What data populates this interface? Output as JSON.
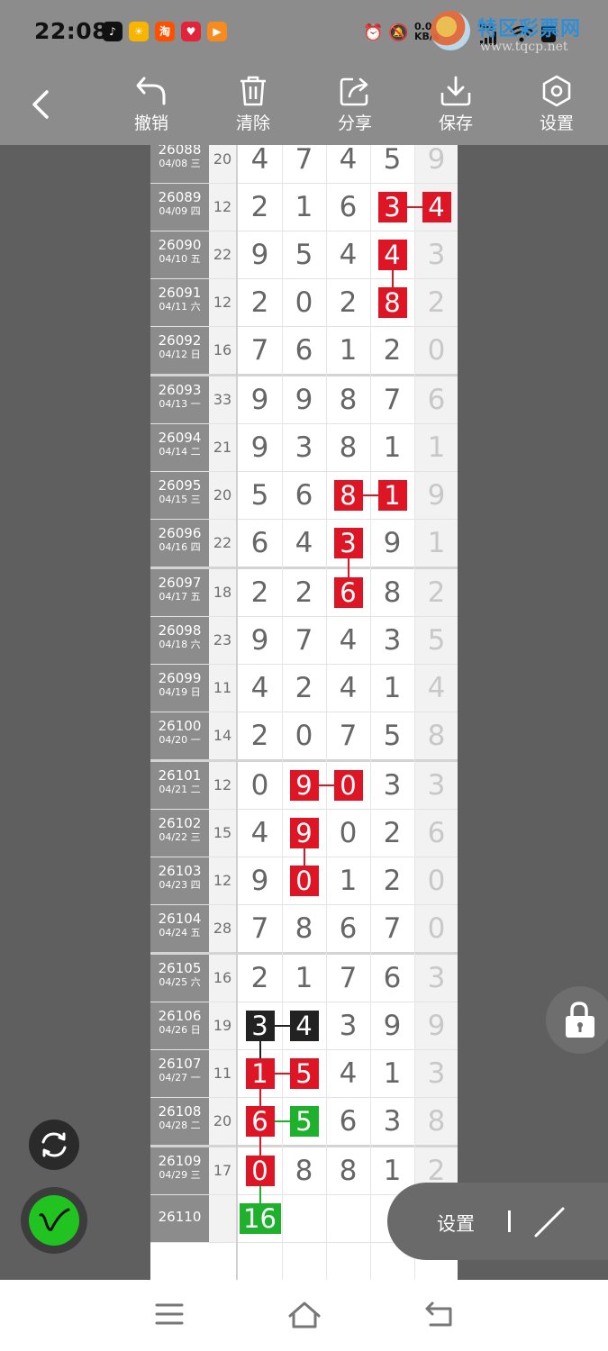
{
  "status_bar": {
    "time": "22:08",
    "apps": [
      {
        "icon": "tiktok-icon",
        "color": "#111111",
        "glyph": "♪"
      },
      {
        "icon": "sun-app-icon",
        "color": "#f7b500",
        "glyph": "☀"
      },
      {
        "icon": "taobao-icon",
        "color": "#ff5000",
        "glyph": "淘"
      },
      {
        "icon": "heart-app-icon",
        "color": "#e2233a",
        "glyph": "♥"
      },
      {
        "icon": "video-app-icon",
        "color": "#f68b1f",
        "glyph": "▶"
      }
    ],
    "net_speed": "0.0",
    "net_unit": "KB/s",
    "net_type": "5G",
    "watermark_title": "特区彩票网",
    "watermark_url": "www.tqcp.net"
  },
  "toolbar": {
    "undo_label": "撤销",
    "clear_label": "清除",
    "share_label": "分享",
    "save_label": "保存",
    "settings_label": "设置"
  },
  "grid": {
    "rows": [
      {
        "id": "26088",
        "date": "04/08 三",
        "sum": "20",
        "d": [
          "4",
          "7",
          "4",
          "5"
        ],
        "extra": "9"
      },
      {
        "id": "26089",
        "date": "04/09 四",
        "sum": "12",
        "d": [
          "2",
          "1",
          "6",
          "3"
        ],
        "extra": "4"
      },
      {
        "id": "26090",
        "date": "04/10 五",
        "sum": "22",
        "d": [
          "9",
          "5",
          "4",
          "4"
        ],
        "extra": "3"
      },
      {
        "id": "26091",
        "date": "04/11 六",
        "sum": "12",
        "d": [
          "2",
          "0",
          "2",
          "8"
        ],
        "extra": "2"
      },
      {
        "id": "26092",
        "date": "04/12 日",
        "sum": "16",
        "d": [
          "7",
          "6",
          "1",
          "2"
        ],
        "extra": "0"
      },
      {
        "id": "26093",
        "date": "04/13 一",
        "sum": "33",
        "d": [
          "9",
          "9",
          "8",
          "7"
        ],
        "extra": "6"
      },
      {
        "id": "26094",
        "date": "04/14 二",
        "sum": "21",
        "d": [
          "9",
          "3",
          "8",
          "1"
        ],
        "extra": "1"
      },
      {
        "id": "26095",
        "date": "04/15 三",
        "sum": "20",
        "d": [
          "5",
          "6",
          "8",
          "1"
        ],
        "extra": "9"
      },
      {
        "id": "26096",
        "date": "04/16 四",
        "sum": "22",
        "d": [
          "6",
          "4",
          "3",
          "9"
        ],
        "extra": "1"
      },
      {
        "id": "26097",
        "date": "04/17 五",
        "sum": "18",
        "d": [
          "2",
          "2",
          "6",
          "8"
        ],
        "extra": "2"
      },
      {
        "id": "26098",
        "date": "04/18 六",
        "sum": "23",
        "d": [
          "9",
          "7",
          "4",
          "3"
        ],
        "extra": "5"
      },
      {
        "id": "26099",
        "date": "04/19 日",
        "sum": "11",
        "d": [
          "4",
          "2",
          "4",
          "1"
        ],
        "extra": "4"
      },
      {
        "id": "26100",
        "date": "04/20 一",
        "sum": "14",
        "d": [
          "2",
          "0",
          "7",
          "5"
        ],
        "extra": "8"
      },
      {
        "id": "26101",
        "date": "04/21 二",
        "sum": "12",
        "d": [
          "0",
          "9",
          "0",
          "3"
        ],
        "extra": "3"
      },
      {
        "id": "26102",
        "date": "04/22 三",
        "sum": "15",
        "d": [
          "4",
          "9",
          "0",
          "2"
        ],
        "extra": "6"
      },
      {
        "id": "26103",
        "date": "04/23 四",
        "sum": "12",
        "d": [
          "9",
          "0",
          "1",
          "2"
        ],
        "extra": "0"
      },
      {
        "id": "26104",
        "date": "04/24 五",
        "sum": "28",
        "d": [
          "7",
          "8",
          "6",
          "7"
        ],
        "extra": "0"
      },
      {
        "id": "26105",
        "date": "04/25 六",
        "sum": "16",
        "d": [
          "2",
          "1",
          "7",
          "6"
        ],
        "extra": "3"
      },
      {
        "id": "26106",
        "date": "04/26 日",
        "sum": "19",
        "d": [
          "3",
          "4",
          "3",
          "9"
        ],
        "extra": "9"
      },
      {
        "id": "26107",
        "date": "04/27 一",
        "sum": "11",
        "d": [
          "1",
          "5",
          "4",
          "1"
        ],
        "extra": "3"
      },
      {
        "id": "26108",
        "date": "04/28 二",
        "sum": "20",
        "d": [
          "6",
          "5",
          "6",
          "3"
        ],
        "extra": "8"
      },
      {
        "id": "26109",
        "date": "04/29 三",
        "sum": "17",
        "d": [
          "0",
          "8",
          "8",
          "1"
        ],
        "extra": "2"
      },
      {
        "id": "26110",
        "date": "",
        "sum": "",
        "d": [
          "16",
          "",
          "",
          ""
        ],
        "extra": ""
      }
    ],
    "marks": [
      {
        "row": 1,
        "col": 3,
        "color": "red"
      },
      {
        "row": 1,
        "col": 4,
        "color": "red"
      },
      {
        "row": 2,
        "col": 3,
        "color": "red"
      },
      {
        "row": 3,
        "col": 3,
        "color": "red"
      },
      {
        "row": 7,
        "col": 2,
        "color": "red"
      },
      {
        "row": 7,
        "col": 3,
        "color": "red"
      },
      {
        "row": 8,
        "col": 2,
        "color": "red"
      },
      {
        "row": 9,
        "col": 2,
        "color": "red"
      },
      {
        "row": 13,
        "col": 1,
        "color": "red"
      },
      {
        "row": 13,
        "col": 2,
        "color": "red"
      },
      {
        "row": 14,
        "col": 1,
        "color": "red"
      },
      {
        "row": 15,
        "col": 1,
        "color": "red"
      },
      {
        "row": 18,
        "col": 0,
        "color": "black"
      },
      {
        "row": 18,
        "col": 1,
        "color": "black"
      },
      {
        "row": 19,
        "col": 0,
        "color": "red"
      },
      {
        "row": 19,
        "col": 1,
        "color": "red"
      },
      {
        "row": 20,
        "col": 0,
        "color": "red"
      },
      {
        "row": 20,
        "col": 1,
        "color": "green"
      },
      {
        "row": 21,
        "col": 0,
        "color": "red"
      },
      {
        "row": 22,
        "col": 0,
        "color": "green"
      }
    ],
    "connectors": [
      {
        "r1": 1,
        "c1": 3,
        "r2": 1,
        "c2": 4,
        "color": "red"
      },
      {
        "r1": 2,
        "c1": 3,
        "r2": 3,
        "c2": 3,
        "color": "red"
      },
      {
        "r1": 7,
        "c1": 2,
        "r2": 7,
        "c2": 3,
        "color": "red"
      },
      {
        "r1": 8,
        "c1": 2,
        "r2": 9,
        "c2": 2,
        "color": "red"
      },
      {
        "r1": 13,
        "c1": 1,
        "r2": 13,
        "c2": 2,
        "color": "red"
      },
      {
        "r1": 14,
        "c1": 1,
        "r2": 15,
        "c2": 1,
        "color": "red"
      },
      {
        "r1": 18,
        "c1": 0,
        "r2": 18,
        "c2": 1,
        "color": "black"
      },
      {
        "r1": 18,
        "c1": 0,
        "r2": 19,
        "c2": 0,
        "color": "black"
      },
      {
        "r1": 19,
        "c1": 0,
        "r2": 19,
        "c2": 1,
        "color": "red"
      },
      {
        "r1": 19,
        "c1": 0,
        "r2": 20,
        "c2": 0,
        "color": "red"
      },
      {
        "r1": 20,
        "c1": 0,
        "r2": 20,
        "c2": 1,
        "color": "green"
      },
      {
        "r1": 20,
        "c1": 0,
        "r2": 21,
        "c2": 0,
        "color": "red"
      },
      {
        "r1": 21,
        "c1": 0,
        "r2": 22,
        "c2": 0,
        "color": "green"
      }
    ],
    "group_breaks": [
      5,
      9,
      13,
      17,
      21
    ]
  },
  "pill": {
    "settings_label": "设置"
  },
  "colors": {
    "toolbar_bg": "#8c8c8c",
    "red": "#dd1524",
    "green": "#1fb02e",
    "black": "#222222"
  }
}
